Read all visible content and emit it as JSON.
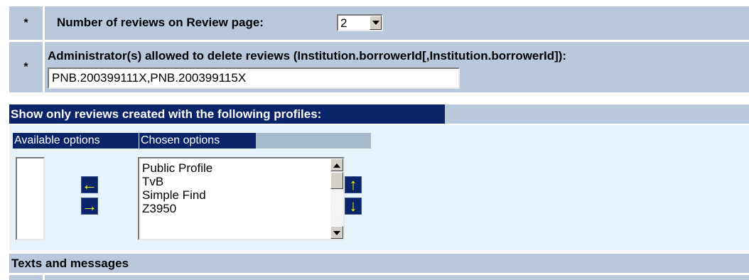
{
  "settings": {
    "reviews_per_page": {
      "marker": "*",
      "label": "Number of reviews on Review page:",
      "value": "2"
    },
    "admins_delete": {
      "marker": "*",
      "label": "Administrator(s) allowed to delete reviews (Institution.borrowerId[,Institution.borrowerId]):",
      "value": "PNB.200399111X,PNB.200399115X"
    }
  },
  "profiles_section": {
    "title": "Show only reviews created with the following profiles:",
    "available_header": "Available options",
    "chosen_header": "Chosen options",
    "available_options": [],
    "chosen_options": [
      "Public Profile",
      "TvB",
      "Simple Find",
      "Z3950"
    ],
    "icons": {
      "move_left": "←",
      "move_right": "→",
      "move_up": "↑",
      "move_down": "↓"
    }
  },
  "texts_section": {
    "title": "Texts and messages"
  },
  "colors": {
    "row_bg": "#B9C9DB",
    "header_dark": "#0A246A",
    "arrow_yellow": "#FFFF00",
    "panel_bg": "#E7F3FB"
  }
}
